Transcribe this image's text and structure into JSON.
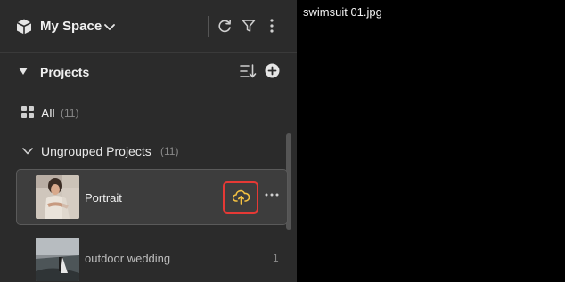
{
  "header": {
    "space_title": "My Space",
    "icons": [
      "cube-icon",
      "chevron-down-icon",
      "refresh-icon",
      "filter-icon",
      "more-vert-icon"
    ]
  },
  "projects": {
    "title": "Projects",
    "icons": [
      "caret-down-icon",
      "sort-icon",
      "add-icon"
    ]
  },
  "all": {
    "label": "All",
    "count": "(11)"
  },
  "group": {
    "label": "Ungrouped Projects",
    "count": "(11)"
  },
  "items": [
    {
      "name": "Portrait",
      "selected": true,
      "icons": [
        "cloud-upload-icon",
        "more-horiz-icon"
      ]
    },
    {
      "name": "outdoor wedding",
      "count": "1"
    }
  ],
  "preview": {
    "file_name": "swimsuit 01.jpg"
  },
  "colors": {
    "sidebar": "#2b2b2b",
    "selected_item": "#3d3d3d",
    "accent_upload": "#f5c242",
    "highlight_border": "#e53935"
  }
}
